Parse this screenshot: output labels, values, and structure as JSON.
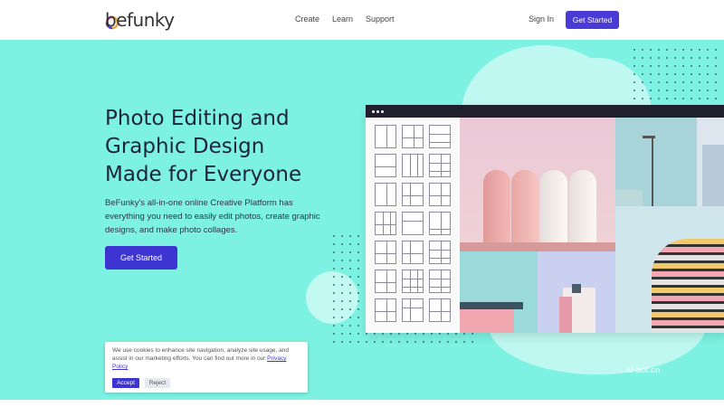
{
  "header": {
    "logo": "befunky",
    "nav": [
      {
        "label": "Create"
      },
      {
        "label": "Learn"
      },
      {
        "label": "Support"
      }
    ],
    "sign_in": "Sign In",
    "get_started": "Get Started"
  },
  "hero": {
    "headline_line1": "Photo Editing and",
    "headline_line2": "Graphic Design",
    "headline_line3": "Made for Everyone",
    "subtext": "BeFunky's all-in-one online Creative Platform has everything you need to easily edit photos, create graphic designs, and make photo collages.",
    "cta": "Get Started"
  },
  "cookie": {
    "text": "We use cookies to enhance site navigation, analyze site usage, and assist in our marketing efforts. You can find out more in our",
    "link": "Privacy Policy",
    "accept": "Accept",
    "reject": "Reject"
  },
  "watermark": "ai-bot.cn",
  "colors": {
    "hero_bg": "#7df2e2",
    "accent": "#3d34d2",
    "blob": "#bff8f0"
  }
}
